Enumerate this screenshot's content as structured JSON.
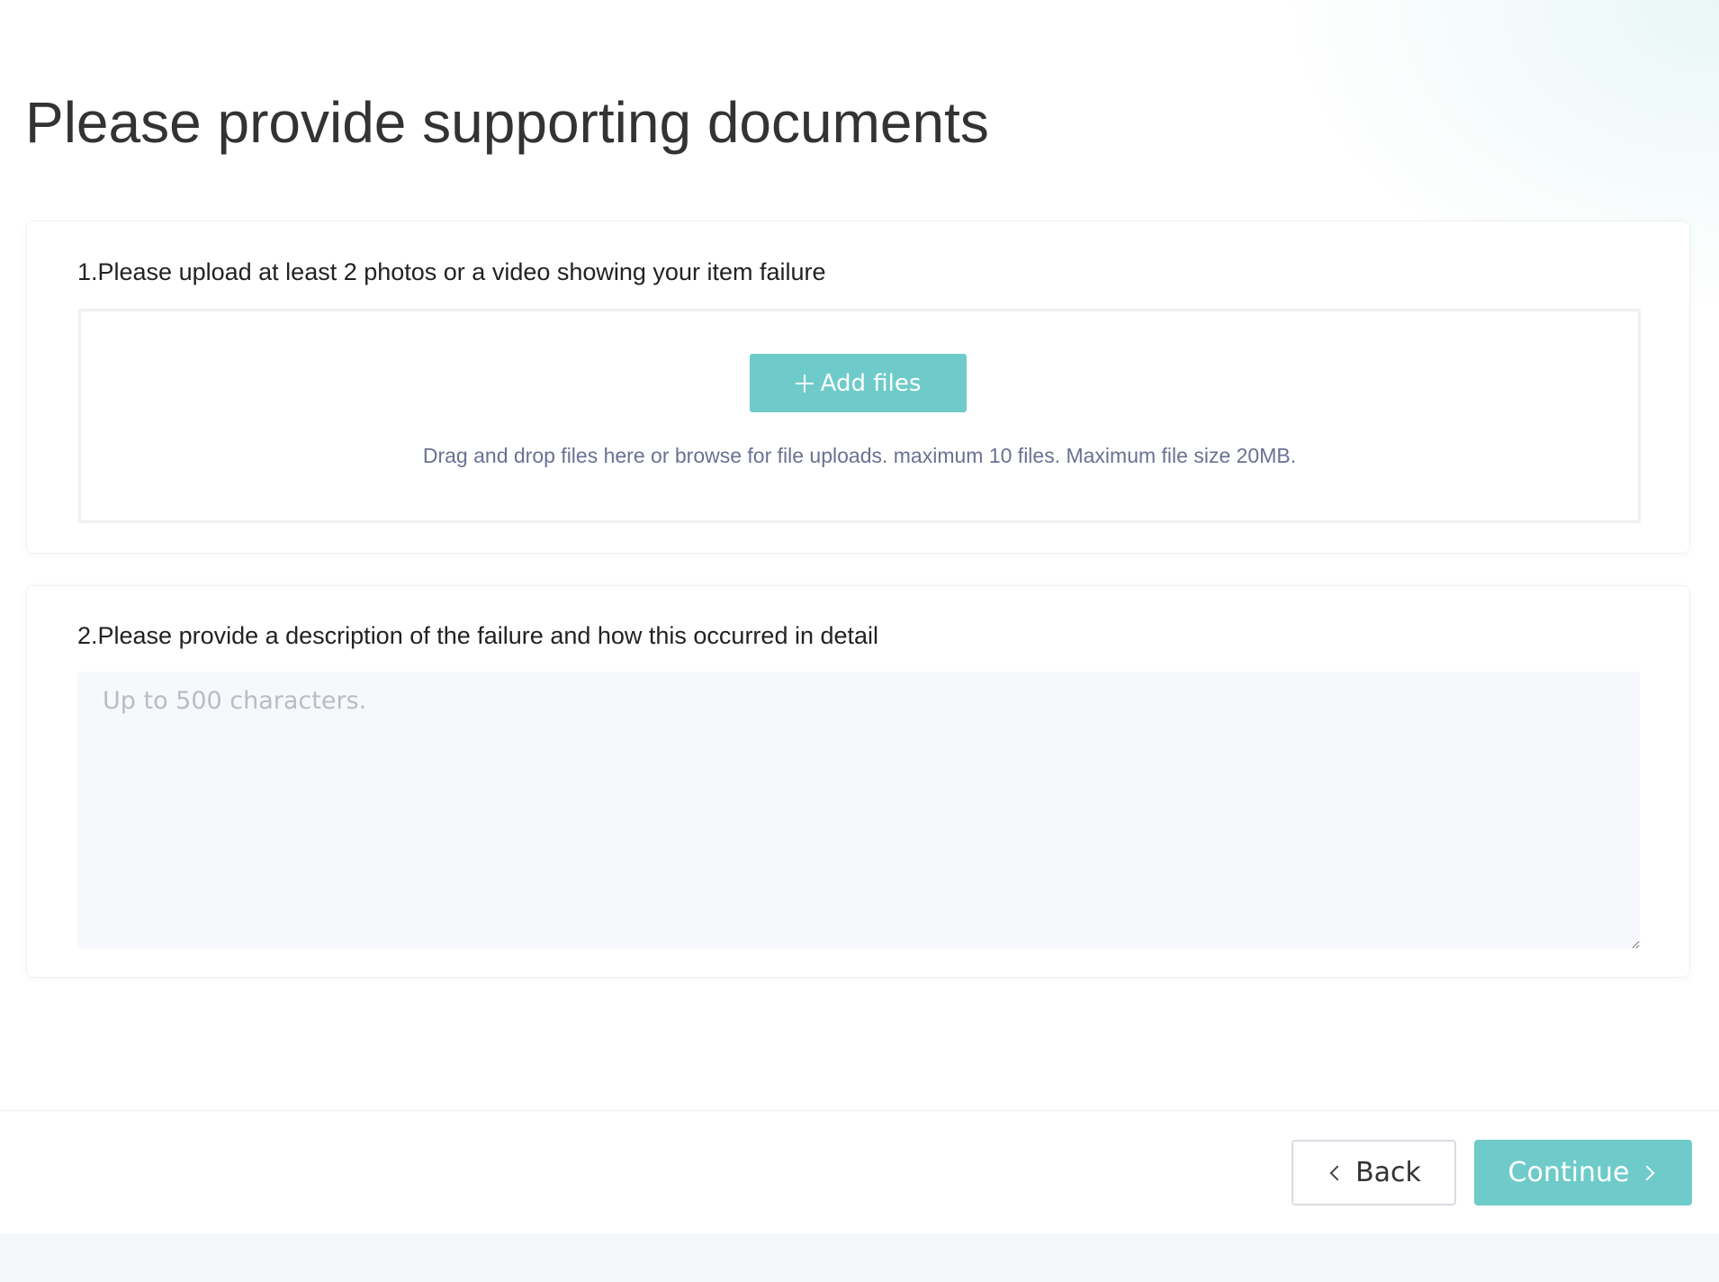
{
  "page": {
    "title": "Please provide supporting documents"
  },
  "upload_section": {
    "heading": "1.Please upload at least 2 photos or a video showing your item failure",
    "add_files_label": "Add files",
    "hint": "Drag and drop files here or browse for file uploads. maximum 10 files. Maximum file size 20MB."
  },
  "description_section": {
    "heading": "2.Please provide a description of the failure and how this occurred in detail",
    "value": "",
    "placeholder": "Up to 500 characters."
  },
  "footer": {
    "back_label": "Back",
    "continue_label": "Continue"
  },
  "icons": {
    "add": "plus-icon",
    "back": "chevron-left-icon",
    "continue": "chevron-right-icon"
  },
  "colors": {
    "accent": "#6ecbc9",
    "title_text": "#333333",
    "hint_text": "#6a7192",
    "textarea_bg": "#f7f8fb"
  }
}
